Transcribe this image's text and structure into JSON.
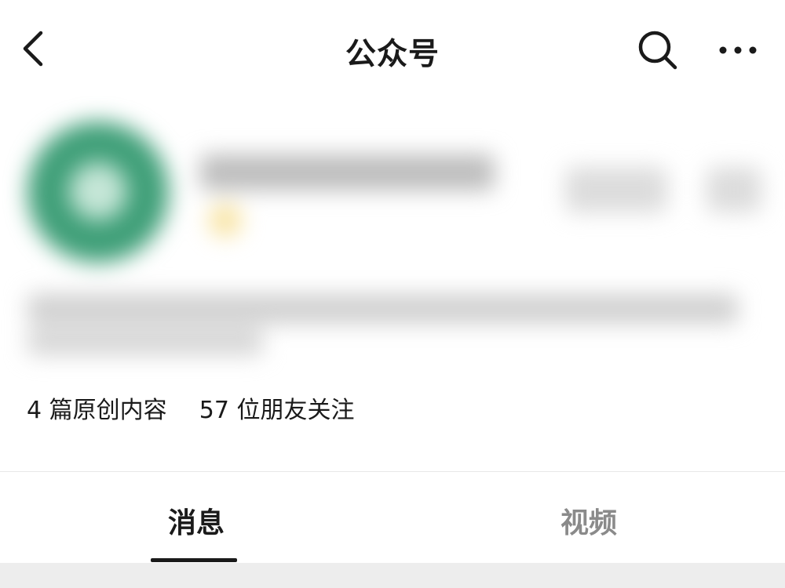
{
  "navbar": {
    "title": "公众号",
    "back_icon": "chevron-left-icon",
    "search_icon": "search-icon",
    "more_icon": "more-horizontal-icon"
  },
  "profile": {
    "avatar_color": "#3f9f78",
    "blurred": true
  },
  "stats": {
    "original_count": "4",
    "original_label": "篇原创内容",
    "follower_count": "57",
    "follower_label": "位朋友关注"
  },
  "tabs": [
    {
      "label": "消息",
      "active": true
    },
    {
      "label": "视频",
      "active": false
    }
  ],
  "colors": {
    "text_primary": "#1a1a1a",
    "text_secondary": "#8a8a8a",
    "divider": "#e8e8e8",
    "bottom_band": "#ededed"
  }
}
